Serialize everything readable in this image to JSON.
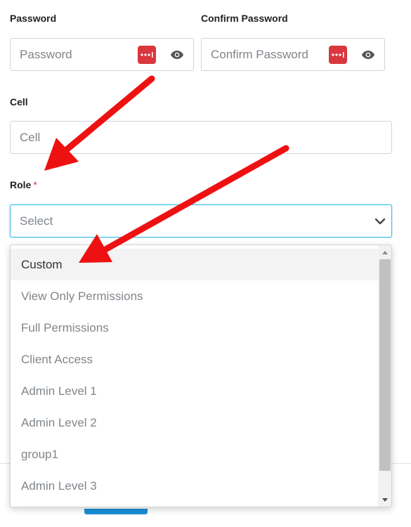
{
  "password": {
    "label": "Password",
    "placeholder": "Password"
  },
  "confirm_password": {
    "label": "Confirm Password",
    "placeholder": "Confirm Password"
  },
  "cell": {
    "label": "Cell",
    "placeholder": "Cell"
  },
  "role": {
    "label": "Role",
    "required_mark": "*",
    "selected": "Select",
    "options": [
      "Custom",
      "View Only Permissions",
      "Full Permissions",
      "Client Access",
      "Admin Level 1",
      "Admin Level 2",
      "group1",
      "Admin Level 3"
    ],
    "highlighted_option": "Custom"
  },
  "icons": {
    "password_manager": "password-manager-icon",
    "show_password": "eye-icon",
    "dropdown": "chevron-down-icon"
  },
  "colors": {
    "focus_border": "#3bbfe8",
    "annotation_arrow": "#ee1111",
    "password_manager": "#d9363e",
    "required": "#d9363e"
  }
}
